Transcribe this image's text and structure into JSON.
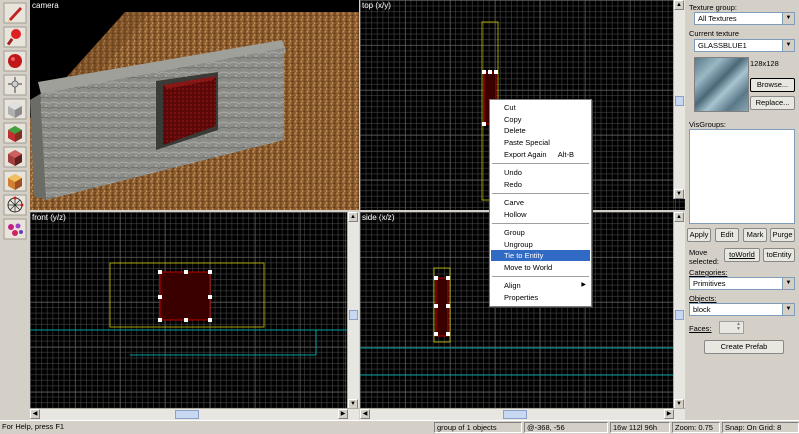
{
  "viewports": {
    "camera": "camera",
    "top": "top (x/y)",
    "front": "front (y/z)",
    "side": "side (x/z)"
  },
  "toolbar": {
    "tools": [
      "selection-tool-icon",
      "magnify-tool-icon",
      "camera-tool-icon",
      "entity-tool-icon",
      "block-tool-icon",
      "texture-tool-icon",
      "apply-texture-icon",
      "decal-tool-icon",
      "clipping-tool-icon",
      "vertex-tool-icon",
      "path-tool-icon"
    ]
  },
  "context_menu": {
    "items": [
      {
        "label": "Cut"
      },
      {
        "label": "Copy"
      },
      {
        "label": "Delete"
      },
      {
        "label": "Paste Special"
      },
      {
        "label": "Export Again",
        "shortcut": "Alt-B"
      },
      {
        "label": "Undo"
      },
      {
        "label": "Redo"
      },
      {
        "label": "Carve"
      },
      {
        "label": "Hollow"
      },
      {
        "label": "Group"
      },
      {
        "label": "Ungroup"
      },
      {
        "label": "Tie to Entity"
      },
      {
        "label": "Move to World"
      },
      {
        "label": "Align"
      },
      {
        "label": "Properties"
      }
    ]
  },
  "panel": {
    "texture_group_label": "Texture group:",
    "texture_group_value": "All Textures",
    "current_texture_label": "Current texture",
    "current_texture_value": "GLASSBLUE1",
    "texture_size": "128x128",
    "browse": "Browse...",
    "replace": "Replace...",
    "visgroups_label": "VisGroups:",
    "apply": "Apply",
    "edit": "Edit",
    "mark": "Mark",
    "purge": "Purge",
    "move_selected_label": "Move selected:",
    "to_world": "toWorld",
    "to_entity": "toEntity",
    "categories_label": "Categories:",
    "categories_value": "Primitives",
    "objects_label": "Objects:",
    "objects_value": "block",
    "faces_label": "Faces:",
    "create_prefab": "Create Prefab"
  },
  "status": {
    "help": "For Help, press F1",
    "selection": "group of 1 objects",
    "coords": "@-368, -56",
    "size": "16w 112l 96h",
    "zoom": "Zoom: 0.75",
    "snap": "Snap: On Grid: 8"
  },
  "colors": {
    "grid_axis": "#00a0a0",
    "selection_box": "#e0e000",
    "selected_brush": "#c00000",
    "menu_highlight": "#316ac5"
  }
}
